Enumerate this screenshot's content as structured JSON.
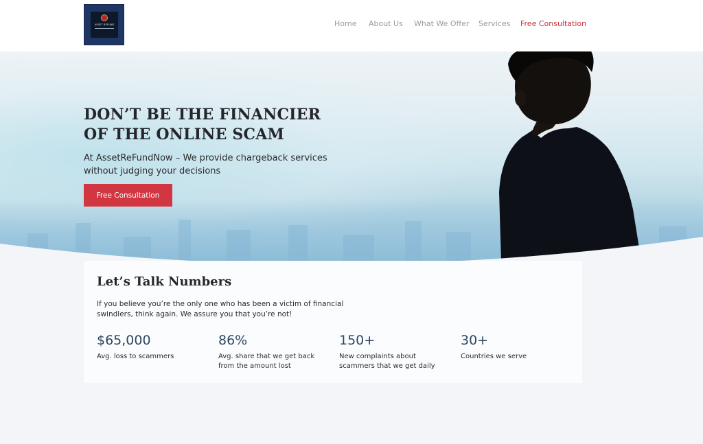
{
  "header": {
    "logo": {
      "brand_text": "ASSET REFUND"
    },
    "nav": [
      {
        "label": "Home"
      },
      {
        "label": "About Us"
      },
      {
        "label": "What We Offer"
      },
      {
        "label": "Services"
      },
      {
        "label": "Free Consultation",
        "active": true
      }
    ]
  },
  "hero": {
    "title": "DON’T BE THE FINANCIER OF THE ONLINE SCAM",
    "subtitle": "At AssetReFundNow – We provide chargeback services without judging your decisions",
    "cta_label": "Free Consultation"
  },
  "numbers": {
    "heading": "Let’s Talk Numbers",
    "description": "If you believe you’re the only one who has been a victim of financial swindlers, think again. We assure you that you’re not!",
    "stats": [
      {
        "value": "$65,000",
        "label": "Avg. loss to scammers"
      },
      {
        "value": "86%",
        "label": "Avg. share that we get back from the amount lost"
      },
      {
        "value": "150+",
        "label": "New complaints about scammers that we get daily"
      },
      {
        "value": "30+",
        "label": "Countries we serve"
      }
    ]
  },
  "colors": {
    "accent": "#d23640",
    "nav_text": "#9a9a9a",
    "stat_value": "#2d4660",
    "logo_bg": "#1f3563"
  }
}
